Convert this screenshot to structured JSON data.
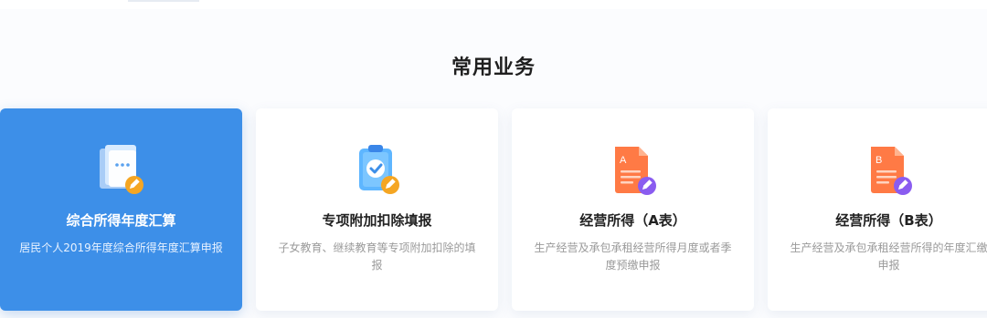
{
  "section": {
    "title": "常用业务"
  },
  "cards": [
    {
      "title": "综合所得年度汇算",
      "desc": "居民个人2019年度综合所得年度汇算申报",
      "icon": "document-pen-icon",
      "active": true
    },
    {
      "title": "专项附加扣除填报",
      "desc": "子女教育、继续教育等专项附加扣除的填报",
      "icon": "clipboard-check-icon",
      "active": false
    },
    {
      "title": "经营所得（A表）",
      "desc": "生产经营及承包承租经营所得月度或者季度预缴申报",
      "icon": "form-a-icon",
      "active": false
    },
    {
      "title": "经营所得（B表）",
      "desc": "生产经营及承包承租经营所得的年度汇缴申报",
      "icon": "form-b-icon",
      "active": false
    }
  ],
  "colors": {
    "active_card": "#3d8fe8",
    "orange_badge": "#f5a623",
    "purple_badge": "#8a5cf0",
    "form_orange": "#ff7a45"
  }
}
